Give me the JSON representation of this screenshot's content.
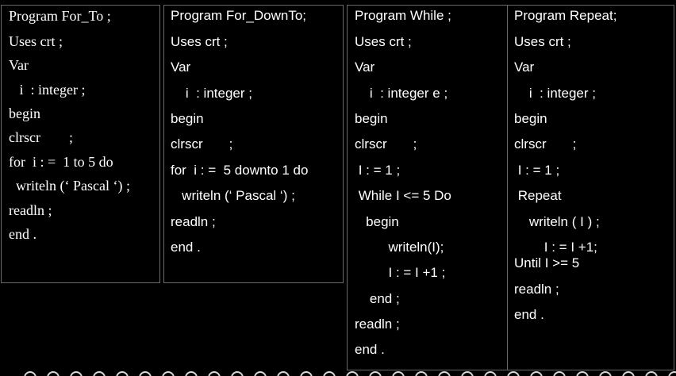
{
  "programs": [
    {
      "lines": [
        "Program For_To ;",
        "Uses crt ;",
        "Var",
        "   i  : integer ;",
        "begin",
        "clrscr        ;",
        "for  i : =  1 to 5 do",
        "  writeln (‘ Pascal ‘) ;",
        "readln ;",
        "end ."
      ]
    },
    {
      "lines": [
        "Program For_DownTo;",
        "Uses crt ;",
        "Var",
        "    i  : integer ;",
        "begin",
        "clrscr       ;",
        "for  i : =  5 downto 1 do",
        "   writeln (‘ Pascal ‘) ;",
        "readln ;",
        "end ."
      ]
    },
    {
      "lines": [
        "Program While ;",
        "Uses crt ;",
        "Var",
        "    i  : integer e ;",
        "begin",
        "clrscr       ;",
        " I : = 1 ;",
        " While I <= 5 Do",
        "   begin",
        "         writeln(I);",
        "         I : = I +1 ;",
        "    end ;",
        "readln ;",
        "end ."
      ]
    },
    {
      "lines": [
        "Program Repeat;",
        "Uses crt ;",
        "Var",
        "    i  : integer ;",
        "begin",
        "clrscr       ;",
        " I : = 1 ;",
        " Repeat",
        "    writeln ( I ) ;",
        "        I : = I +1;",
        "Until I >= 5",
        "readln ;",
        "end ."
      ]
    }
  ]
}
